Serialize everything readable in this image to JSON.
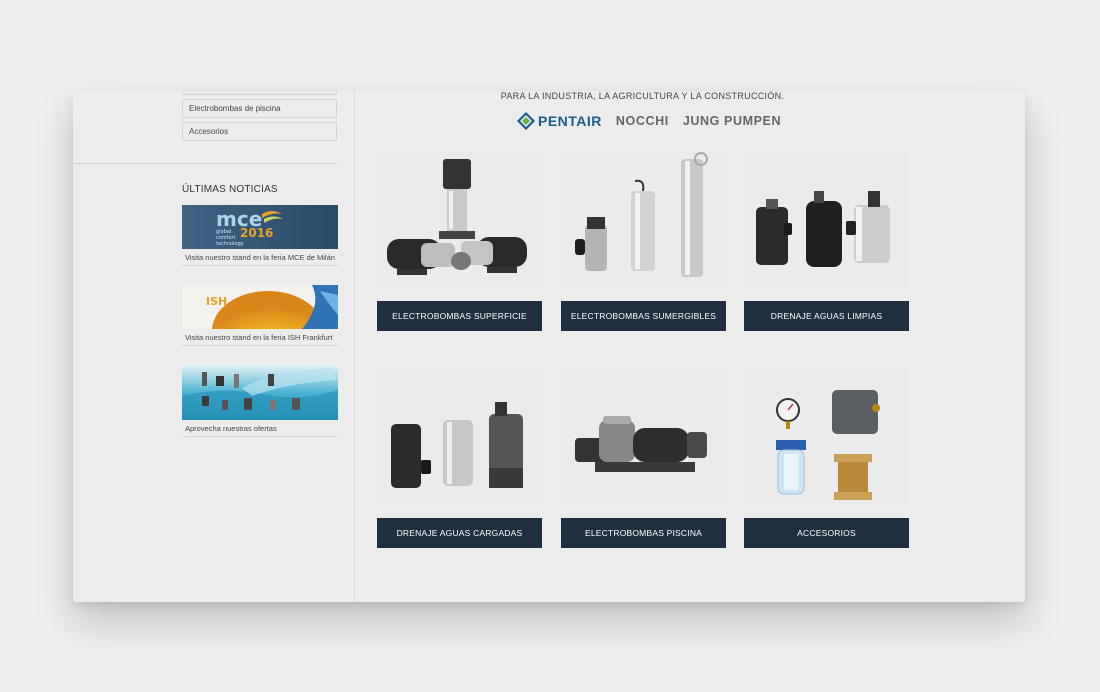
{
  "sidebar": {
    "categories": [
      "Electrobombas de piscina",
      "Accesorios"
    ],
    "news_title": "ÚLTIMAS NOTICIAS",
    "news": [
      {
        "caption": "Visita nuestro stand en la feria MCE de Milán",
        "logo_text": "mce",
        "year": "2016",
        "sub1": "global",
        "sub2": "comfort",
        "sub3": "technology"
      },
      {
        "caption": "Visita nuestro stand en la feria ISH Frankfurt",
        "logo_text": "ISH"
      },
      {
        "caption": "Aprovecha nuestras ofertas"
      }
    ]
  },
  "main": {
    "tagline": "PARA LA INDUSTRIA, LA AGRICULTURA Y LA CONSTRUCCIÓN.",
    "brands": [
      "PENTAIR",
      "NOCCHI",
      "JUNG PUMPEN"
    ],
    "products": [
      {
        "label": "ELECTROBOMBAS SUPERFICIE"
      },
      {
        "label": "ELECTROBOMBAS SUMERGIBLES"
      },
      {
        "label": "DRENAJE AGUAS LIMPIAS"
      },
      {
        "label": "DRENAJE AGUAS CARGADAS"
      },
      {
        "label": "ELECTROBOMBAS PISCINA"
      },
      {
        "label": "ACCESORIOS"
      }
    ]
  },
  "colors": {
    "button_bg": "#1f2f40",
    "pentair_blue": "#1a5c8a",
    "background": "#eeeeee"
  }
}
